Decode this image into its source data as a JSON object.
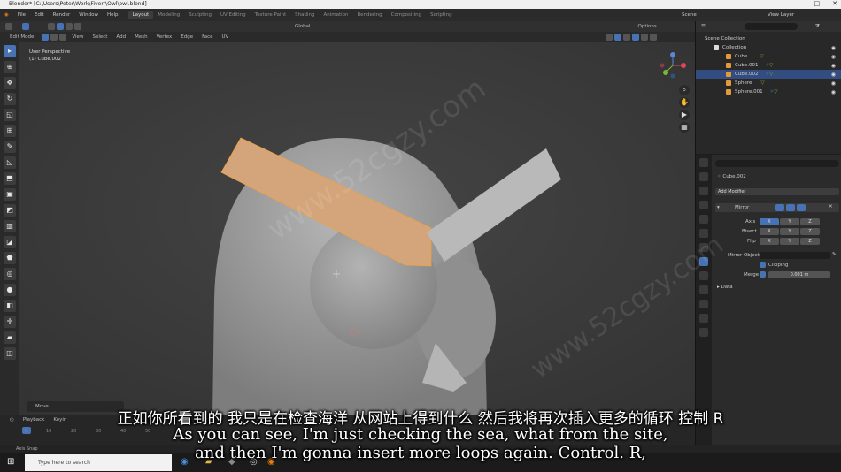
{
  "window": {
    "title": "Blender* [C:\\Users\\Peter\\Work\\Fiverr\\Owl\\owl.blend]"
  },
  "menu": [
    "File",
    "Edit",
    "Render",
    "Window",
    "Help"
  ],
  "workspaces": [
    "Layout",
    "Modeling",
    "Sculpting",
    "UV Editing",
    "Texture Paint",
    "Shading",
    "Animation",
    "Rendering",
    "Compositing",
    "Scripting"
  ],
  "scene": {
    "scene_label": "Scene",
    "view_layer_label": "View Layer"
  },
  "viewport_header": {
    "mode": "Edit Mode",
    "menus": [
      "View",
      "Select",
      "Add",
      "Mesh",
      "Vertex",
      "Edge",
      "Face",
      "UV"
    ],
    "orientation": "Global",
    "options": "Options"
  },
  "viewport": {
    "perspective": "User Perspective",
    "object": "(1) Cube.002",
    "last_op": "Move"
  },
  "outliner": {
    "scene_collection": "Scene Collection",
    "collection": "Collection",
    "objects": [
      {
        "name": "Cube",
        "selected": false
      },
      {
        "name": "Cube.001",
        "selected": false
      },
      {
        "name": "Cube.002",
        "selected": true
      },
      {
        "name": "Sphere",
        "selected": false
      },
      {
        "name": "Sphere.001",
        "selected": false
      }
    ]
  },
  "properties": {
    "object_name": "Cube.002",
    "add_modifier": "Add Modifier",
    "modifier_name": "Mirror",
    "axis_label": "Axis",
    "bisect_label": "Bisect",
    "flip_label": "Flip",
    "axes": [
      "X",
      "Y",
      "Z"
    ],
    "mirror_object_label": "Mirror Object",
    "clipping_label": "Clipping",
    "merge_label": "Merge",
    "merge_value": "0.001 m",
    "data_label": "Data"
  },
  "timeline": {
    "playback": "Playback",
    "keying": "Keyin",
    "ticks": [
      "0",
      "10",
      "20",
      "30",
      "40",
      "50"
    ]
  },
  "status": {
    "text": "Axis Snap"
  },
  "taskbar": {
    "search_placeholder": "Type here to search"
  },
  "subtitles": {
    "cn": "正如你所看到的 我只是在检查海洋 从网站上得到什么 然后我将再次插入更多的循环 控制 R",
    "en1": "As you can see, I'm just checking the sea, what from the site,",
    "en2": "and then I'm gonna insert more loops again. Control. R,"
  },
  "watermark": "www.52cgzy.com",
  "colors": {
    "accent": "#4772b3",
    "selected_mesh": "#d4a57a",
    "mesh": "#a8a8a8"
  }
}
